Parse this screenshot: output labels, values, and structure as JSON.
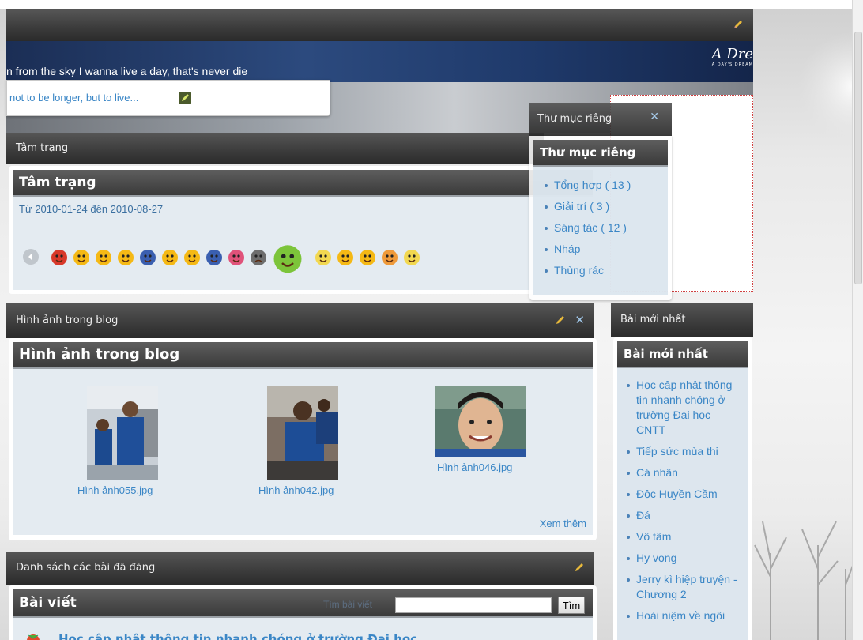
{
  "header": {
    "slogan": "n from the sky I wanna live a day, that's never die",
    "logo_text": "A Dre",
    "logo_subtext": "A DAY'S DREAM",
    "motto": "not to be longer, but to live..."
  },
  "mood": {
    "panel_title": "Tâm trạng",
    "inner_title": "Tâm trạng",
    "date_range": "Từ 2010-01-24 đến 2010-08-27",
    "emoticons": [
      "angry-emoticon",
      "happy-emoticon",
      "happy-emoticon",
      "happy-emoticon",
      "crying-emoticon",
      "happy-emoticon",
      "happy-emoticon",
      "crying-emoticon",
      "kiss-emoticon",
      "sad-emoticon",
      "big-green-emoticon",
      "laughing-emoticon",
      "happy-emoticon",
      "happy-emoticon",
      "embarrassed-emoticon",
      "laughing-emoticon"
    ]
  },
  "folders": {
    "popup_title": "Thư mục riêng",
    "inner_title": "Thư mục riêng",
    "items": [
      {
        "label": "Tổng hợp",
        "count": "( 13 )"
      },
      {
        "label": "Giải trí",
        "count": "( 3 )"
      },
      {
        "label": "Sáng tác",
        "count": "( 12 )"
      },
      {
        "label": "Nháp",
        "count": ""
      },
      {
        "label": "Thùng rác",
        "count": ""
      }
    ]
  },
  "photos": {
    "panel_title": "Hình ảnh trong blog",
    "inner_title": "Hình ảnh trong blog",
    "items": [
      {
        "caption": "Hình ảnh055.jpg"
      },
      {
        "caption": "Hình ảnh042.jpg"
      },
      {
        "caption": "Hình ảnh046.jpg"
      }
    ],
    "more_link": "Xem thêm"
  },
  "latest": {
    "panel_title": "Bài mới nhất",
    "inner_title": "Bài mới nhất",
    "items": [
      "Học cập nhật thông tin nhanh chóng ở trường Đại học CNTT",
      "Tiếp sức mùa thi",
      "Cá nhân",
      "Độc Huyền Cầm",
      "Đá",
      "Vô tâm",
      "Hy vọng",
      "Jerry kì hiệp truyện - Chương 2",
      "Hoài niệm về ngôi"
    ]
  },
  "posts": {
    "panel_title": "Danh sách các bài đã đăng",
    "inner_title": "Bài viết",
    "search_label": "Tìm bài viết",
    "search_value": "",
    "search_button": "Tìm",
    "first_post_title": "Học cập nhật thông tin nhanh chóng ở trường Đại học"
  },
  "colors": {
    "link": "#3a86c6",
    "bar_dark": "#3d3d3d",
    "panel_body": "#e4ebf1"
  }
}
